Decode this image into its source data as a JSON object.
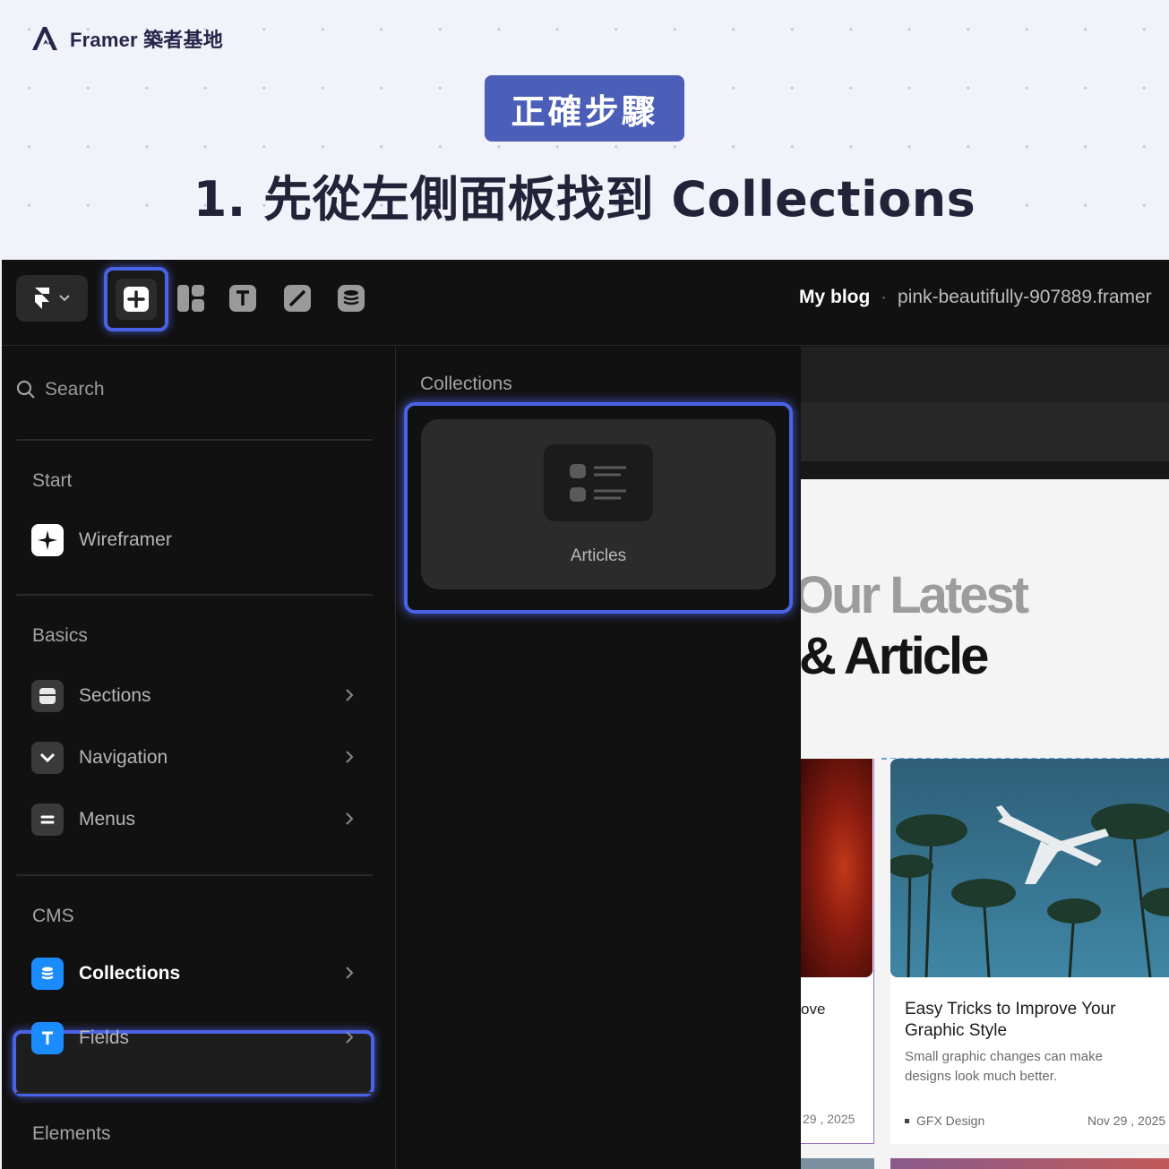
{
  "header": {
    "brand_name": "Framer 築者基地",
    "badge": "正確步驟",
    "step_title": "1. 先從左側面板找到 Collections"
  },
  "toolbar": {
    "tools": [
      "insert-icon",
      "layout-icon",
      "text-icon",
      "vector-icon",
      "cms-icon"
    ],
    "project_name": "My blog",
    "separator": "·",
    "project_url": "pink-beautifully-907889.framer"
  },
  "left_panel": {
    "search_placeholder": "Search",
    "start": {
      "heading": "Start",
      "items": [
        {
          "label": "Wireframer",
          "icon": "sparkle-icon"
        }
      ]
    },
    "basics": {
      "heading": "Basics",
      "items": [
        {
          "label": "Sections",
          "icon": "section-icon"
        },
        {
          "label": "Navigation",
          "icon": "chevron-down-icon"
        },
        {
          "label": "Menus",
          "icon": "menu-icon"
        }
      ]
    },
    "cms": {
      "heading": "CMS",
      "items": [
        {
          "label": "Collections",
          "icon": "database-icon",
          "color": "#1a8cff"
        },
        {
          "label": "Fields",
          "icon": "text-icon",
          "color": "#1a8cff"
        }
      ]
    },
    "elements_heading": "Elements"
  },
  "middle_panel": {
    "title": "Collections",
    "card_label": "Articles"
  },
  "preview": {
    "hero_line1": "Our Latest",
    "hero_line2": "& Article",
    "left_card_partial_title": "ove",
    "left_card_partial_date": "29 , 2025",
    "article": {
      "title": "Easy Tricks to Improve Your Graphic Style",
      "description": "Small graphic changes can make designs look much better.",
      "category": "GFX Design",
      "date": "Nov 29 , 2025"
    }
  },
  "colors": {
    "highlight": "#4a63e6",
    "badge": "#4c5fb8",
    "cms_blue": "#1a8cff"
  }
}
